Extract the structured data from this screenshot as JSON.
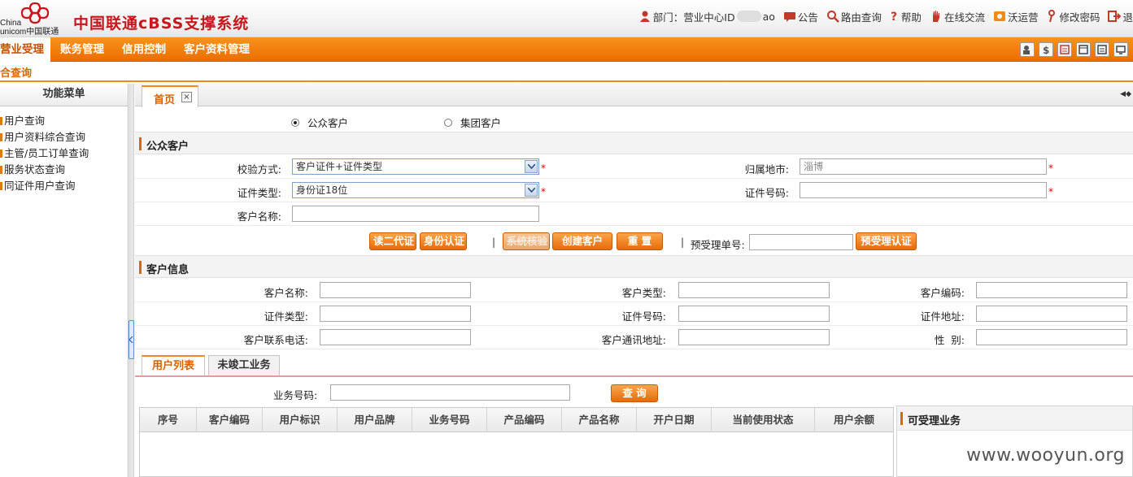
{
  "header": {
    "logo_text": "China unicom中国联通",
    "system_title": "中国联通cBSS支撑系统",
    "department_prefix": "部门：营业中心ID",
    "department_suffix": "ao",
    "links": {
      "notice": "公告",
      "route_query": "路由查询",
      "help": "帮助",
      "online_chat": "在线交流",
      "wo_ops": "沃运营",
      "change_password": "修改密码",
      "logout": "退"
    }
  },
  "main_nav": {
    "items": [
      "营业受理",
      "账务管理",
      "信用控制",
      "客户资料管理"
    ],
    "active_index": 0
  },
  "sub_nav": {
    "active": "合查询"
  },
  "left_menu": {
    "title": "功能菜单",
    "items": [
      "用户查询",
      "用户资料综合查询",
      "主管/员工订单查询",
      "服务状态查询",
      "同证件用户查询"
    ]
  },
  "tabs": {
    "home": "首页",
    "close": "×"
  },
  "customer_type": {
    "options": [
      "公众客户",
      "集团客户"
    ],
    "selected": "公众客户"
  },
  "public_customer": {
    "section_title": "公众客户",
    "verify_method_label": "校验方式:",
    "verify_method_value": "客户证件+证件类型",
    "region_label": "归属地市:",
    "region_value": "淄博",
    "id_type_label": "证件类型:",
    "id_type_value": "身份证18位",
    "id_number_label": "证件号码:",
    "id_number_value": "",
    "name_label": "客户名称:",
    "name_value": "",
    "required_mark": "*"
  },
  "actions": {
    "read_id": "读二代证",
    "id_auth": "身份认证",
    "sys_verify": "系统核验",
    "create_customer": "创建客户",
    "reset": "重 置",
    "separator": "|",
    "pre_order_label": "预受理单号:",
    "pre_order_value": "",
    "pre_order_auth": "预受理认证"
  },
  "customer_info": {
    "section_title": "客户信息",
    "fields": {
      "name": "客户名称:",
      "type": "客户类型:",
      "code": "客户编码:",
      "id_type": "证件类型:",
      "id_number": "证件号码:",
      "id_address": "证件地址:",
      "phone": "客户联系电话:",
      "mail_address": "客户通讯地址:",
      "gender": "性  别:"
    }
  },
  "bottom_tabs": [
    "用户列表",
    "未竣工业务"
  ],
  "user_list": {
    "service_number_label": "业务号码:",
    "service_number_value": "",
    "query_button": "查 询",
    "columns": [
      "序号",
      "客户编码",
      "用户标识",
      "用户品牌",
      "业务号码",
      "产品编码",
      "产品名称",
      "开户日期",
      "当前使用状态",
      "用户余额"
    ],
    "rows": []
  },
  "side_panel": {
    "title": "可受理业务"
  },
  "watermark": "www.wooyun.org",
  "colors": {
    "accent": "#ec6d00",
    "brand_red": "#c8161d"
  }
}
